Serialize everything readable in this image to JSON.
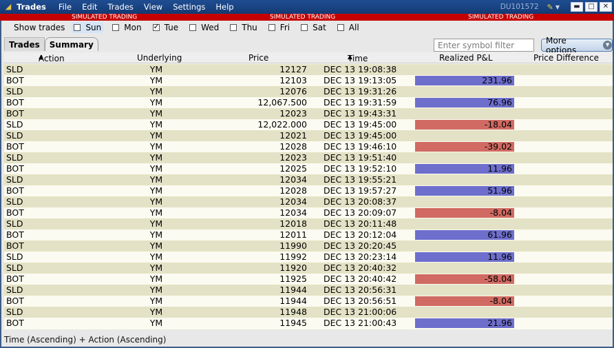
{
  "titlebar": {
    "title": "Trades",
    "menu": [
      "File",
      "Edit",
      "Trades",
      "View",
      "Settings",
      "Help"
    ],
    "account": "DU101572",
    "minimize": "▬",
    "restore": "□",
    "close": "✕"
  },
  "banner": {
    "text": "SIMULATED TRADING",
    "color": "#c40000"
  },
  "show_trades": {
    "label": "Show trades",
    "days": [
      {
        "label": "Sun",
        "checked": false
      },
      {
        "label": "Mon",
        "checked": false
      },
      {
        "label": "Tue",
        "checked": true
      },
      {
        "label": "Wed",
        "checked": false
      },
      {
        "label": "Thu",
        "checked": false
      },
      {
        "label": "Fri",
        "checked": false
      },
      {
        "label": "Sat",
        "checked": false
      },
      {
        "label": "All",
        "checked": false
      }
    ]
  },
  "tabs": [
    {
      "label": "Trades",
      "active": false
    },
    {
      "label": "Summary",
      "active": true
    }
  ],
  "symbol_filter": {
    "placeholder": "Enter symbol filter",
    "value": ""
  },
  "more_options": {
    "label": "More options"
  },
  "columns": {
    "action": "Action",
    "underlying": "Underlying",
    "price": "Price",
    "time": "Time",
    "pnl": "Realized P&L",
    "price_diff": "Price Difference"
  },
  "colors": {
    "pnl_positive": "#6e6ecd",
    "pnl_negative": "#d06a62",
    "row_alt": "#e4e2c6",
    "row_plain": "#fbfbf1"
  },
  "rows": [
    {
      "action": "SLD",
      "underlying": "YM",
      "price": "12127",
      "time": "DEC 13 19:08:38",
      "pnl": ""
    },
    {
      "action": "BOT",
      "underlying": "YM",
      "price": "12103",
      "time": "DEC 13 19:13:05",
      "pnl": "231.96"
    },
    {
      "action": "SLD",
      "underlying": "YM",
      "price": "12076",
      "time": "DEC 13 19:31:26",
      "pnl": ""
    },
    {
      "action": "BOT",
      "underlying": "YM",
      "price": "12,067.500",
      "time": "DEC 13 19:31:59",
      "pnl": "76.96"
    },
    {
      "action": "BOT",
      "underlying": "YM",
      "price": "12023",
      "time": "DEC 13 19:43:31",
      "pnl": ""
    },
    {
      "action": "SLD",
      "underlying": "YM",
      "price": "12,022.000",
      "time": "DEC 13 19:45:00",
      "pnl": "-18.04"
    },
    {
      "action": "SLD",
      "underlying": "YM",
      "price": "12021",
      "time": "DEC 13 19:45:00",
      "pnl": ""
    },
    {
      "action": "BOT",
      "underlying": "YM",
      "price": "12028",
      "time": "DEC 13 19:46:10",
      "pnl": "-39.02"
    },
    {
      "action": "SLD",
      "underlying": "YM",
      "price": "12023",
      "time": "DEC 13 19:51:40",
      "pnl": ""
    },
    {
      "action": "BOT",
      "underlying": "YM",
      "price": "12025",
      "time": "DEC 13 19:52:10",
      "pnl": "11.96"
    },
    {
      "action": "SLD",
      "underlying": "YM",
      "price": "12034",
      "time": "DEC 13 19:55:21",
      "pnl": ""
    },
    {
      "action": "BOT",
      "underlying": "YM",
      "price": "12028",
      "time": "DEC 13 19:57:27",
      "pnl": "51.96"
    },
    {
      "action": "SLD",
      "underlying": "YM",
      "price": "12034",
      "time": "DEC 13 20:08:37",
      "pnl": ""
    },
    {
      "action": "BOT",
      "underlying": "YM",
      "price": "12034",
      "time": "DEC 13 20:09:07",
      "pnl": "-8.04"
    },
    {
      "action": "SLD",
      "underlying": "YM",
      "price": "12018",
      "time": "DEC 13 20:11:48",
      "pnl": ""
    },
    {
      "action": "BOT",
      "underlying": "YM",
      "price": "12011",
      "time": "DEC 13 20:12:04",
      "pnl": "61.96"
    },
    {
      "action": "BOT",
      "underlying": "YM",
      "price": "11990",
      "time": "DEC 13 20:20:45",
      "pnl": ""
    },
    {
      "action": "SLD",
      "underlying": "YM",
      "price": "11992",
      "time": "DEC 13 20:23:14",
      "pnl": "11.96"
    },
    {
      "action": "SLD",
      "underlying": "YM",
      "price": "11920",
      "time": "DEC 13 20:40:32",
      "pnl": ""
    },
    {
      "action": "BOT",
      "underlying": "YM",
      "price": "11925",
      "time": "DEC 13 20:40:42",
      "pnl": "-58.04"
    },
    {
      "action": "SLD",
      "underlying": "YM",
      "price": "11944",
      "time": "DEC 13 20:56:31",
      "pnl": ""
    },
    {
      "action": "BOT",
      "underlying": "YM",
      "price": "11944",
      "time": "DEC 13 20:56:51",
      "pnl": "-8.04"
    },
    {
      "action": "SLD",
      "underlying": "YM",
      "price": "11948",
      "time": "DEC 13 21:00:06",
      "pnl": ""
    },
    {
      "action": "BOT",
      "underlying": "YM",
      "price": "11945",
      "time": "DEC 13 21:00:43",
      "pnl": "21.96"
    }
  ],
  "status": {
    "text": "Time (Ascending)  +  Action (Ascending)"
  }
}
